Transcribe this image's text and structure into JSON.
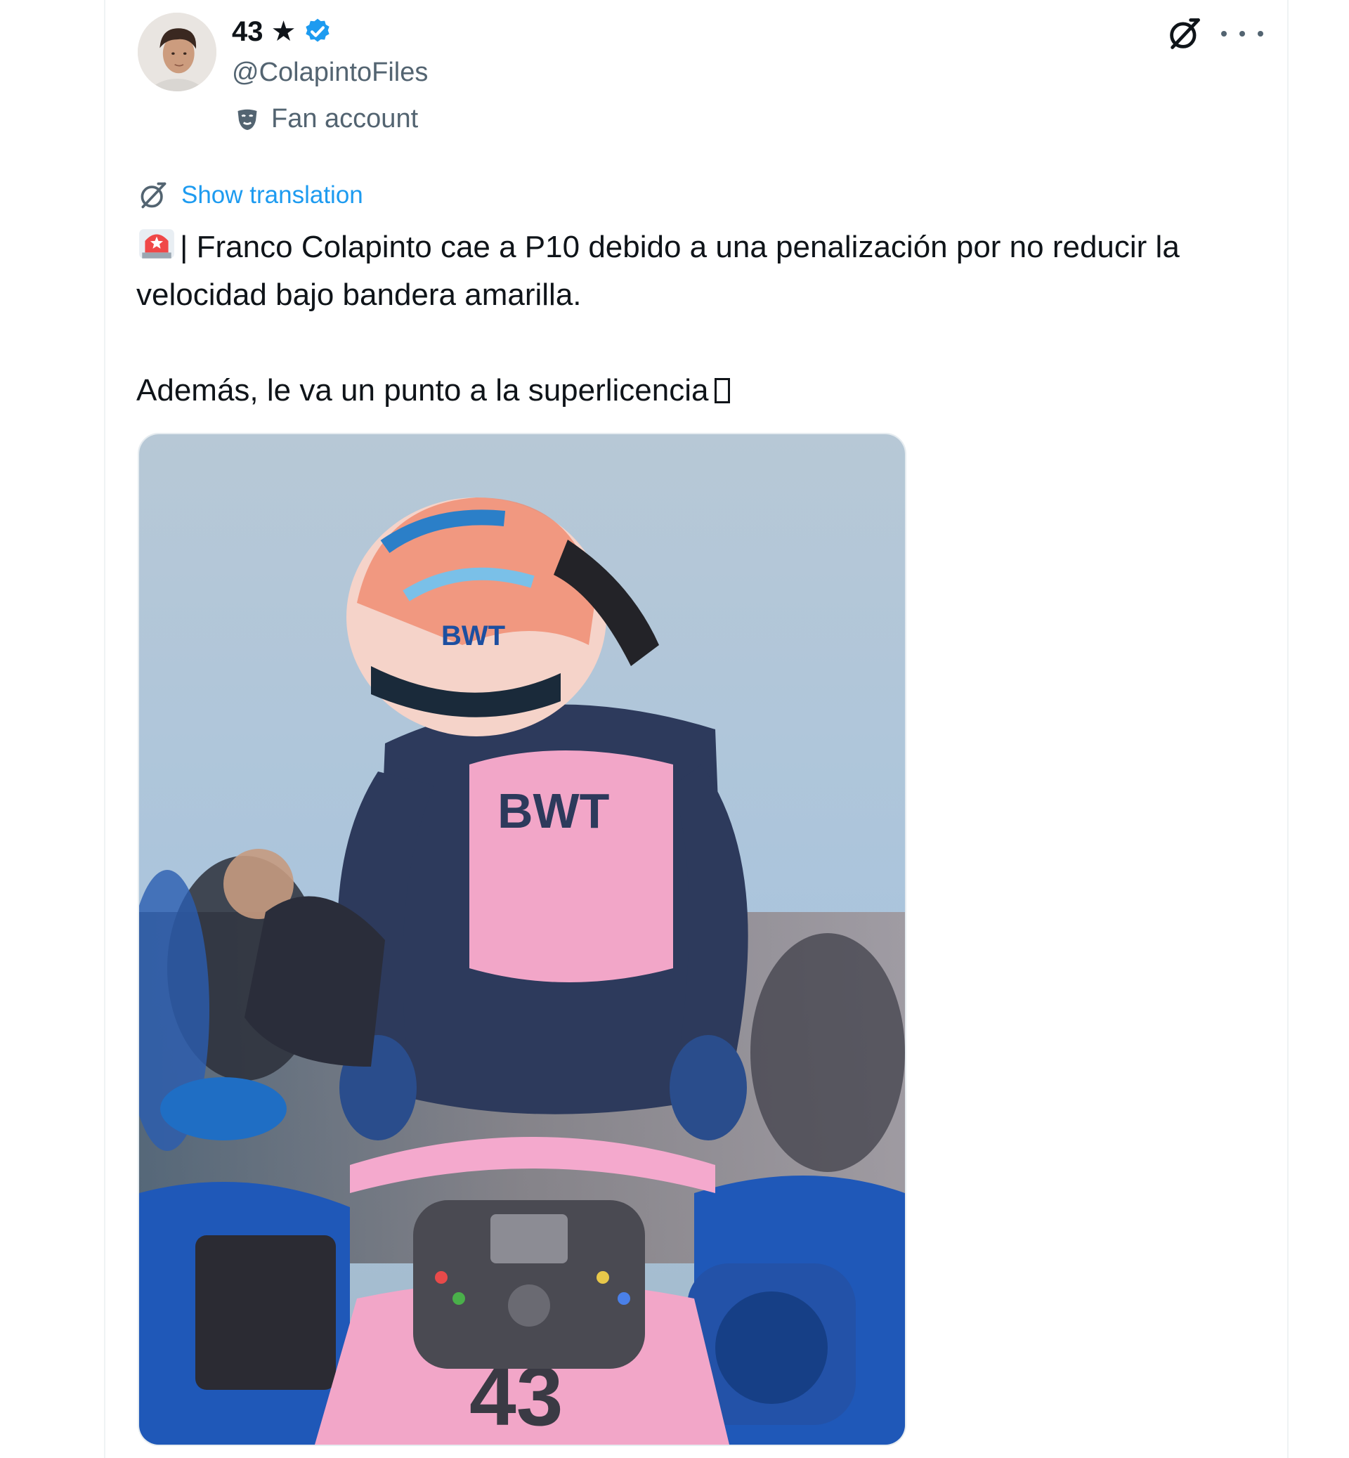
{
  "author": {
    "display_name": "43 ★",
    "handle": "@ColapintoFiles",
    "label": "Fan account",
    "verified": true
  },
  "actions": {
    "grok_icon": "grok-icon",
    "more_icon": "more-options-icon"
  },
  "translation": {
    "link": "Show translation"
  },
  "tweet": {
    "line1": "| Franco Colapinto cae a P10 debido a una penalización por no reducir la velocidad bajo bandera amarilla.",
    "line2": "Además, le va un punto a la superlicencia"
  },
  "media": {
    "alt_icon": "photo",
    "car_number": "43"
  },
  "colors": {
    "accent": "#1d9bf0",
    "secondary_text": "#536471",
    "text": "#0f1419",
    "alpine_pink": "#f2a6c8",
    "alpine_blue": "#1f58b8"
  }
}
